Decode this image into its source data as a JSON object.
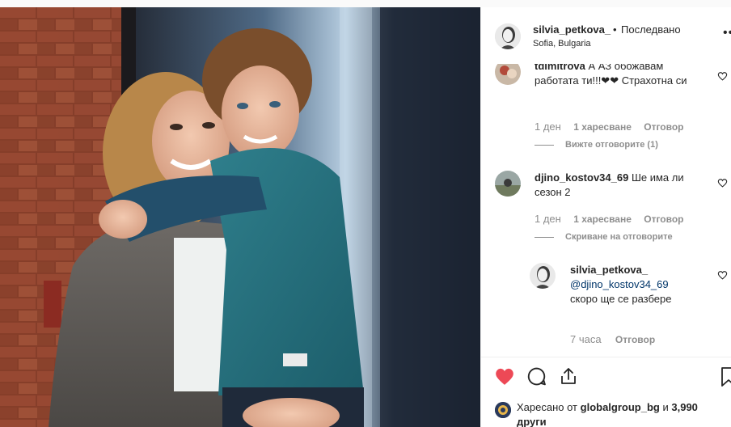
{
  "post": {
    "username": "silvia_petkova_",
    "separator": "•",
    "follow_status": "Последвано",
    "location": "Sofia, Bulgaria",
    "more_label": "•••"
  },
  "comments": [
    {
      "username": "tdimitrova",
      "text": "А АЗ обожавам работата ти!!!❤❤ Страхотна си ",
      "age": "1 ден",
      "likes": "1 харесване",
      "reply_label": "Отговор",
      "replies_toggle": "Вижте отговорите (1)"
    },
    {
      "username": "djino_kostov34_69",
      "text": "Ше има ли сезон 2 ",
      "age": "1 ден",
      "likes": "1 харесване",
      "reply_label": "Отговор",
      "replies_toggle": "Скриване на отговорите"
    }
  ],
  "reply": {
    "username": "silvia_petkova_",
    "mention": "@djino_kostov34_69",
    "text": "скоро ще се разбере  ",
    "age": "7 часа",
    "reply_label": "Отговор"
  },
  "likes": {
    "prefix": "Харесано от",
    "user": "globalgroup_bg",
    "joiner": "и",
    "count": "3,990 други"
  },
  "icons": {
    "heart": "heart-filled-icon",
    "comment": "comment-icon",
    "share": "share-icon",
    "save": "bookmark-icon",
    "like_outline": "heart-outline-icon"
  },
  "colors": {
    "liked_heart": "#ed4956",
    "link": "#003569",
    "meta": "#8e8e8e"
  }
}
